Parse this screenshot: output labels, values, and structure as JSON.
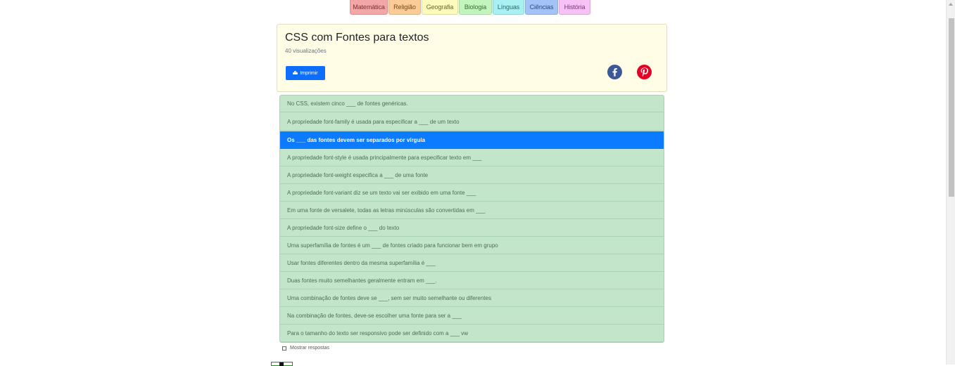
{
  "subjects": [
    {
      "label": "Matemática",
      "color": "#f4a6a6"
    },
    {
      "label": "Religião",
      "color": "#fbcc98"
    },
    {
      "label": "Geografia",
      "color": "#fdfbbc"
    },
    {
      "label": "Biologia",
      "color": "#c2f5bc"
    },
    {
      "label": "Línguas",
      "color": "#a9f0f2"
    },
    {
      "label": "Ciências",
      "color": "#a3c3f7"
    },
    {
      "label": "História",
      "color": "#f6c1f4"
    }
  ],
  "header": {
    "title": "CSS com Fontes para textos",
    "views": "40 visualizações",
    "print_label": "Imprimir",
    "social": [
      "facebook-icon",
      "pinterest-icon"
    ],
    "facebook_color": "#3b5998",
    "pinterest_color": "#e60023"
  },
  "questions": [
    "No CSS, existem cinco ___ de fontes genéricas.",
    "A propriedade font-family é usada para especificar a ___ de um texto",
    "Os ___ das fontes devem ser separados por vírgula",
    "A propriedade font-style é usada principalmente para especificar texto em ___",
    "A propriedade font-weight especifica a ___ de uma fonte",
    "A propriedade font-variant diz se um texto vai ser exibido em uma fonte ___",
    "Em uma fonte de versalete, todas as letras minúsculas são convertidas em ___",
    "A propriedade font-size define o ___ do texto",
    "Uma superfamília de fontes é um ___ de fontes criado para funcionar bem em grupo",
    "Usar fontes diferentes dentro da mesma superfamília é ___",
    "Duas fontes muito semelhantes geralmente entram em ___.",
    "Uma combinação de fontes deve se ___, sem ser muito semelhante ou diferentes",
    "Na combinação de fontes, deve-se escolher uma fonte para ser a ___",
    "Para o tamanho do texto ser responsivo pode ser definido com a ___ vw"
  ],
  "active_question_index": 2,
  "show_answers_label": "Mostrar respostas",
  "colors": {
    "list_bg": "#c3e6cb",
    "active_bg": "#0d7bff",
    "header_bg": "#fffde6",
    "print_button": "#0d6efd"
  }
}
